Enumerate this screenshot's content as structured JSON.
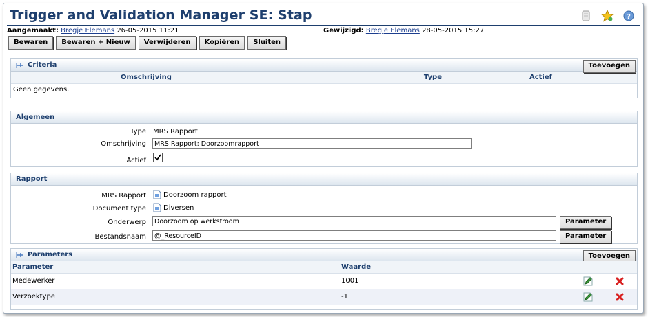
{
  "title": "Trigger and Validation Manager SE: Stap",
  "title_icons": [
    "document-icon",
    "star-icon",
    "help-icon"
  ],
  "meta": {
    "created_label": "Aangemaakt:",
    "created_by": "Bregje Elemans",
    "created_at": "26-05-2015 11:21",
    "modified_label": "Gewijzigd:",
    "modified_by": "Bregje Elemans",
    "modified_at": "28-05-2015 15:27"
  },
  "toolbar": {
    "save": "Bewaren",
    "save_new": "Bewaren + Nieuw",
    "delete": "Verwijderen",
    "copy": "Kopiëren",
    "close": "Sluiten"
  },
  "criteria": {
    "title": "Criteria",
    "add": "Toevoegen",
    "columns": [
      "Omschrijving",
      "Type",
      "Actief"
    ],
    "empty": "Geen gegevens."
  },
  "algemeen": {
    "title": "Algemeen",
    "type_label": "Type",
    "type_value": "MRS Rapport",
    "desc_label": "Omschrijving",
    "desc_value": "MRS Rapport: Doorzoomrapport",
    "active_label": "Actief",
    "active_checked": true
  },
  "rapport": {
    "title": "Rapport",
    "mrs_label": "MRS Rapport",
    "mrs_value": "Doorzoom rapport",
    "doctype_label": "Document type",
    "doctype_value": "Diversen",
    "subject_label": "Onderwerp",
    "subject_value": "Doorzoom op werkstroom",
    "filename_label": "Bestandsnaam",
    "filename_value": "@_ResourceID",
    "param_button": "Parameter"
  },
  "parameters": {
    "title": "Parameters",
    "add": "Toevoegen",
    "columns": [
      "Parameter",
      "Waarde"
    ],
    "rows": [
      {
        "parameter": "Medewerker",
        "waarde": "1001"
      },
      {
        "parameter": "Verzoektype",
        "waarde": "-1"
      }
    ]
  },
  "colors": {
    "accent": "#1e3f6e",
    "link": "#1c3e8f",
    "delete": "#d82020"
  }
}
